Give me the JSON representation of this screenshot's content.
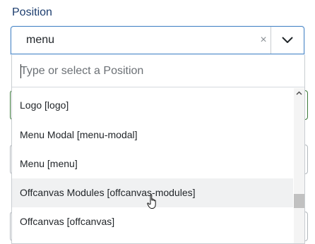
{
  "field": {
    "label": "Position",
    "value": "menu",
    "clear_symbol": "×",
    "toggle_icon": "chevron-down-icon"
  },
  "dropdown": {
    "search_placeholder": "Type or select a Position",
    "items": [
      {
        "label": "Logo [logo]"
      },
      {
        "label": "Menu Modal [menu-modal]"
      },
      {
        "label": "Menu [menu]"
      },
      {
        "label": "Offcanvas Modules [offcanvas-modules]",
        "hovered": true
      },
      {
        "label": "Offcanvas [offcanvas]"
      }
    ]
  },
  "colors": {
    "label": "#1c3d6e",
    "focus_border": "#4d89c8",
    "hover_bg": "#f0f1f2",
    "valid_border": "#3c7a3b"
  }
}
